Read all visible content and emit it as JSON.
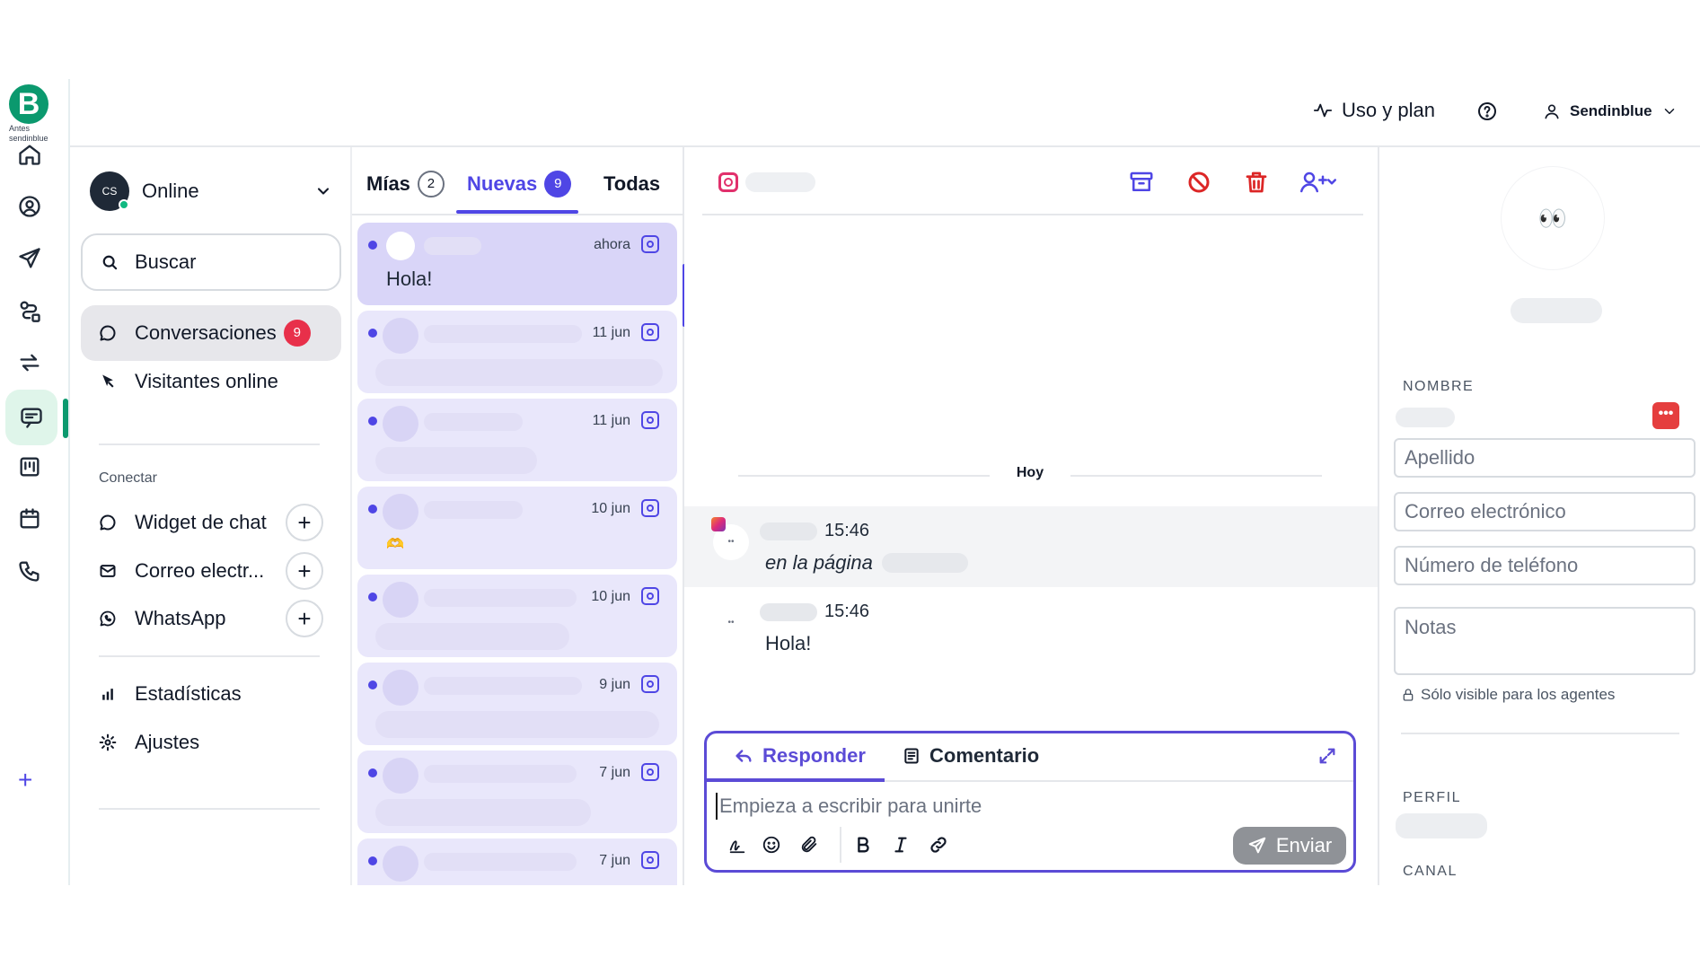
{
  "brand": {
    "logo_letter": "B",
    "caption": "Antes sendinblue",
    "accent": "#0b996e"
  },
  "topbar": {
    "usage_label": "Uso y plan",
    "account_label": "Sendinblue"
  },
  "sidebar": {
    "status": {
      "initials": "CS",
      "label": "Online"
    },
    "search_label": "Buscar",
    "conversations_label": "Conversaciones",
    "conversations_count": "9",
    "visitors_label": "Visitantes online",
    "connect_heading": "Conectar",
    "connect_items": [
      {
        "label": "Widget de chat"
      },
      {
        "label": "Correo electr..."
      },
      {
        "label": "WhatsApp"
      }
    ],
    "stats_label": "Estadísticas",
    "settings_label": "Ajustes"
  },
  "conv_list": {
    "tabs": [
      {
        "label": "Mías",
        "count": "2"
      },
      {
        "label": "Nuevas",
        "count": "9"
      },
      {
        "label": "Todas"
      }
    ],
    "items": [
      {
        "date": "ahora",
        "message": "Hola!"
      },
      {
        "date": "11 jun"
      },
      {
        "date": "11 jun"
      },
      {
        "date": "10 jun",
        "emoji": "🫶"
      },
      {
        "date": "10 jun"
      },
      {
        "date": "9 jun"
      },
      {
        "date": "7 jun"
      },
      {
        "date": "7 jun"
      }
    ]
  },
  "chat": {
    "day_separator": "Hoy",
    "messages": [
      {
        "time": "15:46",
        "text": "en la página"
      },
      {
        "time": "15:46",
        "text": "Hola!"
      }
    ],
    "composer": {
      "reply_tab": "Responder",
      "comment_tab": "Comentario",
      "placeholder": "Empieza a escribir para unirte",
      "send_label": "Enviar"
    }
  },
  "contact": {
    "avatar_emoji": "👀",
    "name_label": "NOMBRE",
    "more_label": "•••",
    "fields": {
      "last_name": "Apellido",
      "email": "Correo electrónico",
      "phone": "Número de teléfono",
      "notes": "Notas"
    },
    "notes_hint": "Sólo visible para los agentes",
    "profile_label": "PERFIL",
    "channel_label": "CANAL"
  }
}
